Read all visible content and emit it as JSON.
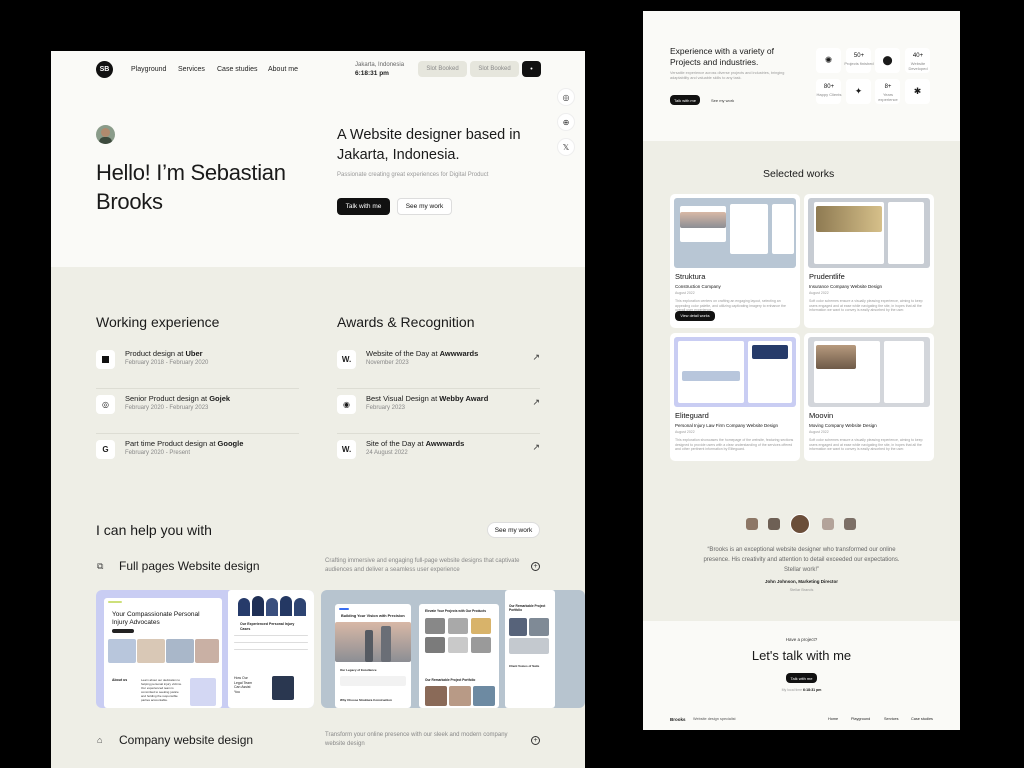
{
  "left": {
    "logo": "SB",
    "nav": [
      "Playground",
      "Services",
      "Case studies",
      "About me"
    ],
    "location": "Jakarta, Indonesia",
    "time": "6:18:31 pm",
    "slot1": "Slot Booked",
    "slot2": "Slot Booked",
    "greeting_line1": "Hello! I’m Sebastian",
    "greeting_line2": "Brooks",
    "headline_line1": "A Website designer based in",
    "headline_line2": "Jakarta, Indonesia.",
    "subheadline": "Passionate creating great experiences for Digital Product",
    "cta_primary": "Talk with me",
    "cta_secondary": "See my work",
    "experience_title": "Working experience",
    "experience": [
      {
        "role": "Product design at ",
        "company": "Uber",
        "icon": "U",
        "dates": "February 2018 - February 2020"
      },
      {
        "role": "Senior Product design at ",
        "company": "Gojek",
        "icon": "◎",
        "dates": "February 2020 - February 2023"
      },
      {
        "role": "Part time Product design at ",
        "company": "Google",
        "icon": "G",
        "dates": "February 2020 - Present"
      }
    ],
    "awards_title": "Awards & Recognition",
    "awards": [
      {
        "title": "Website of the Day at ",
        "org": "Awwwards",
        "icon": "W.",
        "date": "November 2023"
      },
      {
        "title": "Best Visual Design at ",
        "org": "Webby Award",
        "icon": "◉",
        "date": "February 2023"
      },
      {
        "title": "Site of the Day at ",
        "org": "Awwwards",
        "icon": "W.",
        "date": "24 August 2022"
      }
    ],
    "help_title": "I can help you with",
    "help_button": "See my work",
    "services": [
      {
        "title": "Full pages Website design",
        "desc": "Crafting immersive and engaging full-page website designs that captivate audiences and deliver a seamless user experience"
      },
      {
        "title": "Company website design",
        "desc": "Transform your online presence with our sleek and modern company website design"
      }
    ],
    "preview1": {
      "heading": "Your Compassionate Personal Injury Advocates",
      "about": "About us",
      "about_text": "Learn about our dedication to helping personal injury victims. Our experienced team is committed to seeking justice and holding the responsible parties accountable.",
      "side_heading": "Our Experienced Personal Injury Cases",
      "legal": "How Our Legal Team Can Assist You"
    },
    "preview2": {
      "heading": "Building Your Vision with Precision",
      "legacy": "Our Legacy of Excellence",
      "why": "Why Choose Struktura Construction",
      "elevate": "Elevate Your Projects with Our Products",
      "remarkable": "Our Remarkable Project Portfolio",
      "remarkable2": "Our Remarkable Project Portfolio",
      "client": "Client Voices of Satis"
    }
  },
  "right": {
    "exp_title": "Experience with a variety of Projects and industries.",
    "exp_desc": "Versatile experience across diverse projects and industries, bringing adaptability and valuable skills to any task.",
    "talk": "Talk with me",
    "see": "See my work",
    "stats": [
      {
        "n": "50+",
        "l": "Projects finished"
      },
      {
        "n": "40+",
        "l": "Website Developed"
      },
      {
        "n": "80+",
        "l": "Happy Clients"
      },
      {
        "n": "8+",
        "l": "Years experience"
      }
    ],
    "works_title": "Selected works",
    "works": [
      {
        "name": "Struktura",
        "sub": "Construction Company",
        "date": "August 2022",
        "desc": "This exploration centers on crafting an engaging layout, selecting an appealing color palette, and utilizing captivating imagery to enhance the overall user experience",
        "btn": "View detail works"
      },
      {
        "name": "Prudentlife",
        "sub": "Insurance Company Website Design",
        "date": "August 2022",
        "desc": "Soft color schemes ensure a visually pleasing experience, aiming to keep users engaged and at ease while navigating the site, in hopes that all the information we want to convey is easily absorbed by the user."
      },
      {
        "name": "Eliteguard",
        "sub": "Personal Injury Law Firm Company Website Design",
        "date": "August 2022",
        "desc": "This exploration showcases the homepage of the website, featuring sections designed to provide users with a clear understanding of the services offered and other pertinent information by Eliteguard."
      },
      {
        "name": "Moovin",
        "sub": "Moving Company Website Design",
        "date": "August 2022",
        "desc": "Soft color schemes ensure a visually pleasing experience, aiming to keep users engaged and at ease while navigating the site, in hopes that all the information we want to convey is easily absorbed by the user."
      }
    ],
    "testimonial": "“Brooks is an exceptional website designer who transformed our online presence. His creativity and attention to detail exceeded our expectations. Stellar work!”",
    "author": "John Johnson, Marketing Director",
    "company": "Stellar Brands",
    "have_project": "Have a project?",
    "lets_talk": "Let's talk with me",
    "footer_btn": "Talk with me",
    "footer_loc": "My local time",
    "footer_time": "6:18:31 pm",
    "footer_brand": "Brooks",
    "footer_tag": "Website design specialist",
    "footer_nav": [
      "Home",
      "Playground",
      "Services",
      "Case studies"
    ]
  },
  "colors": {
    "bg": "#eeeee6",
    "hero": "#fafaf7",
    "dark": "#111111",
    "muted": "#888888"
  }
}
